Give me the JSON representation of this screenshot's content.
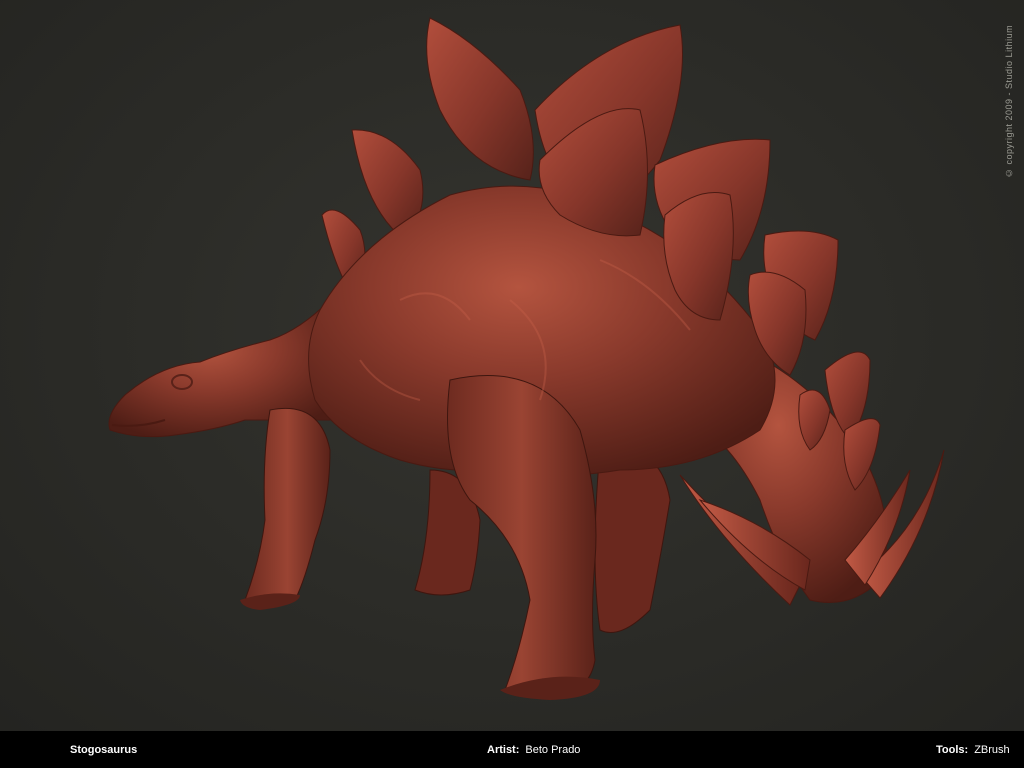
{
  "image": {
    "subject": "stegosaurus",
    "colors": {
      "background": "#2b2b27",
      "skin": "#8a3a2c",
      "skin_highlight": "#c8604a",
      "skin_shadow": "#4a1a12",
      "footer": "#000000"
    }
  },
  "copyright": "© copyright 2009 - Studio Lithium",
  "footer": {
    "title": "Stogosaurus",
    "artist_label": "Artist:",
    "artist": "Beto Prado",
    "tools_label": "Tools:",
    "tools": "ZBrush"
  }
}
